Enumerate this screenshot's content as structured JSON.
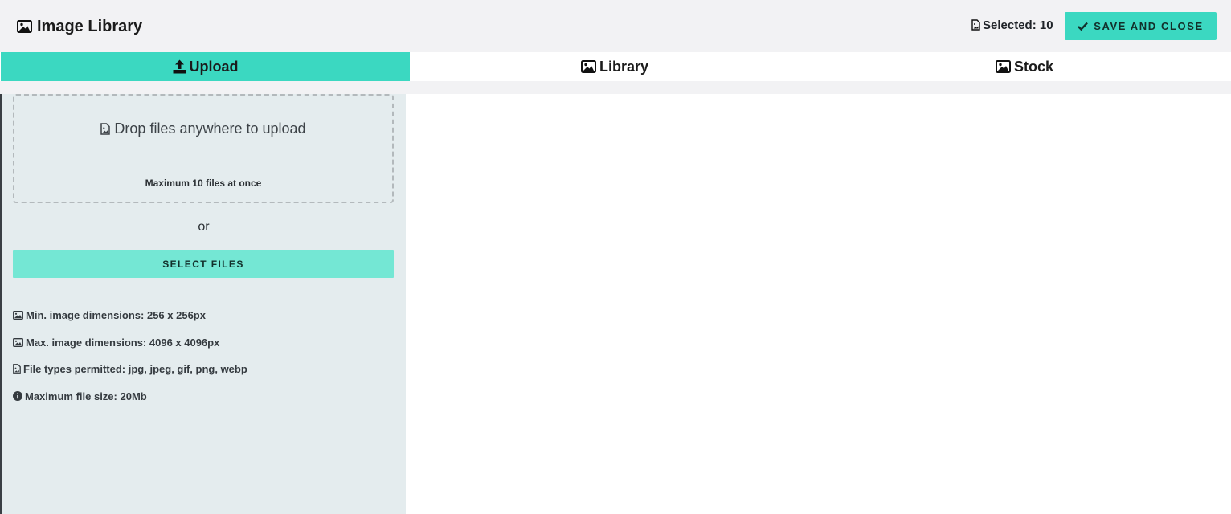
{
  "header": {
    "title": "Image Library",
    "title_icon": "image-icon",
    "selected_label": "Selected: 10",
    "selected_icon": "file-image-icon",
    "save_label": "SAVE AND CLOSE",
    "save_icon": "check-icon"
  },
  "tabs": [
    {
      "label": "Upload",
      "icon": "upload-icon",
      "active": true
    },
    {
      "label": "Library",
      "icon": "image-icon",
      "active": false
    },
    {
      "label": "Stock",
      "icon": "image-icon",
      "active": false
    }
  ],
  "upload": {
    "drop_title": "Drop files anywhere to upload",
    "drop_icon": "file-image-icon",
    "drop_note": "Maximum 10 files at once",
    "or_text": "or",
    "select_files_label": "SELECT FILES",
    "info": [
      {
        "icon": "image-icon",
        "text": "Min. image dimensions: 256 x 256px"
      },
      {
        "icon": "image-icon",
        "text": "Max. image dimensions: 4096 x 4096px"
      },
      {
        "icon": "file-image-icon",
        "text": "File types permitted: jpg, jpeg, gif, png, webp"
      },
      {
        "icon": "info-circle-icon",
        "text": "Maximum file size: 20Mb"
      }
    ]
  },
  "colors": {
    "accent": "#3bd8c1",
    "accent_light": "#74e7d4",
    "panel_bg": "#e4ecee",
    "header_bg": "#f2f2f4"
  }
}
